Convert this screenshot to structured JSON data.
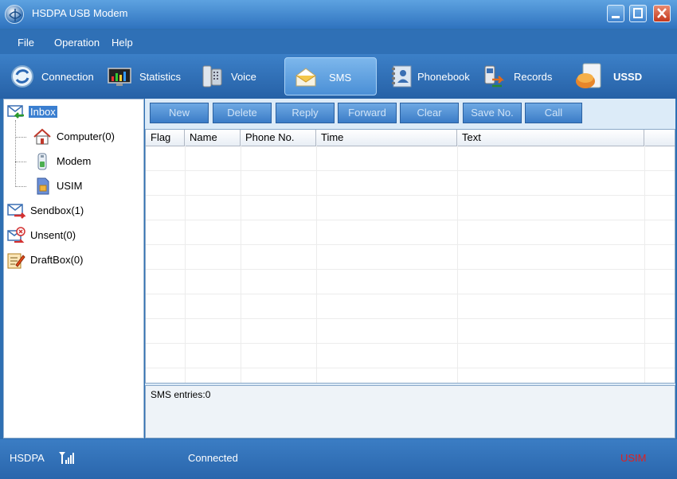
{
  "window": {
    "title": "HSDPA USB Modem",
    "app_icon": "globe-icon"
  },
  "menu": {
    "items": [
      {
        "label": "File"
      },
      {
        "label": "Operation"
      },
      {
        "label": "Help"
      }
    ]
  },
  "toolbar": {
    "active": "SMS",
    "items": [
      {
        "label": "Connection",
        "icon": "connection-icon"
      },
      {
        "label": "Statistics",
        "icon": "statistics-icon"
      },
      {
        "label": "Voice",
        "icon": "phone-icon"
      },
      {
        "label": "SMS",
        "icon": "sms-envelope-icon"
      },
      {
        "label": "Phonebook",
        "icon": "phonebook-icon"
      },
      {
        "label": "Records",
        "icon": "records-icon"
      },
      {
        "label": "USSD",
        "icon": "ussd-icon"
      }
    ]
  },
  "sidebar": {
    "items": [
      {
        "label": "Inbox",
        "icon": "inbox-icon",
        "selected": true
      },
      {
        "label": "Computer(0)",
        "icon": "home-icon"
      },
      {
        "label": "Modem",
        "icon": "modem-icon"
      },
      {
        "label": "USIM",
        "icon": "sim-card-icon"
      },
      {
        "label": "Sendbox(1)",
        "icon": "sendbox-icon"
      },
      {
        "label": "Unsent(0)",
        "icon": "unsent-icon"
      },
      {
        "label": "DraftBox(0)",
        "icon": "draftbox-icon"
      }
    ]
  },
  "actions": {
    "buttons": [
      {
        "label": "New"
      },
      {
        "label": "Delete"
      },
      {
        "label": "Reply"
      },
      {
        "label": "Forward"
      },
      {
        "label": "Clear"
      },
      {
        "label": "Save No."
      },
      {
        "label": "Call"
      }
    ]
  },
  "table": {
    "columns": [
      "Flag",
      "Name",
      "Phone No.",
      "Time",
      "Text"
    ],
    "rows": []
  },
  "sms_status": {
    "text": "SMS entries:0"
  },
  "statusbar": {
    "network": "HSDPA",
    "signal_icon": "signal-strength-icon",
    "connection": "Connected",
    "sim": "USIM",
    "sim_color": "#e02020"
  },
  "colors": {
    "accent": "#2f70b6",
    "selected": "#3b7fd0"
  }
}
